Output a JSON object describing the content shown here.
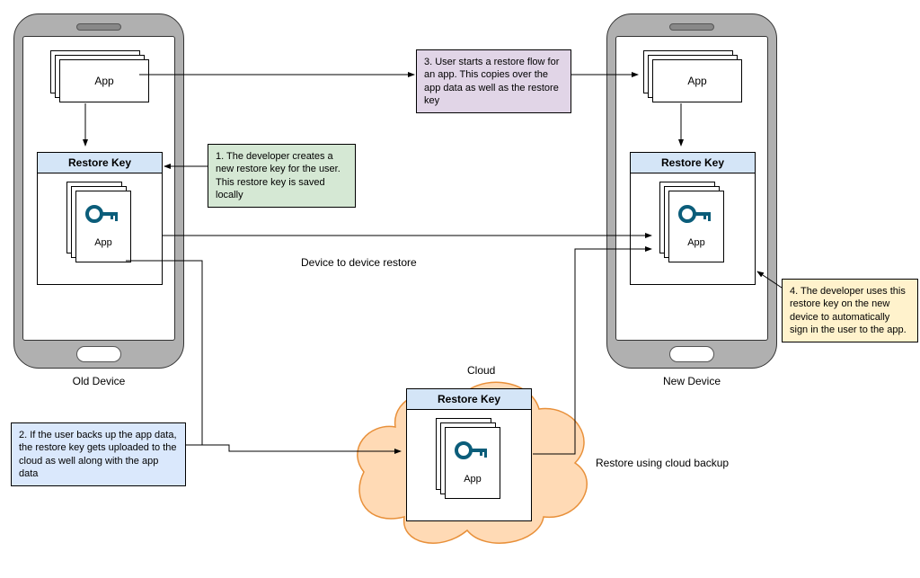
{
  "oldDevice": {
    "label": "Old Device",
    "appLabel": "App",
    "restoreLabel": "Restore Key",
    "restoreAppLabel": "App"
  },
  "newDevice": {
    "label": "New Device",
    "appLabel": "App",
    "restoreLabel": "Restore Key",
    "restoreAppLabel": "App"
  },
  "cloud": {
    "label": "Cloud",
    "restoreLabel": "Restore Key",
    "restoreAppLabel": "App"
  },
  "notes": {
    "n1": "1. The developer creates a new restore key for the user. This restore key is saved locally",
    "n2": "2. If the user backs up the app data, the restore key gets uploaded to the cloud as well along with the app data",
    "n3": "3. User starts a restore flow for an app. This copies over the app data as well as the restore key",
    "n4": "4. The developer uses this restore key on the new device to automatically sign in the user to the app."
  },
  "edges": {
    "deviceToDevice": "Device to device restore",
    "cloudRestore": "Restore using cloud backup"
  }
}
